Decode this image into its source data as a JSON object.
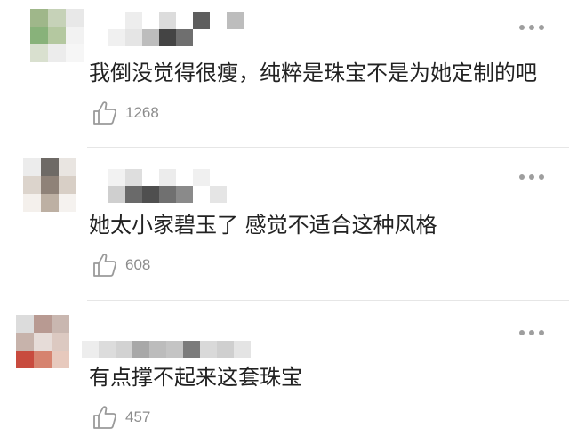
{
  "colors": {
    "text": "#222222",
    "muted": "#8c8c8c",
    "divider": "#e6e6e6"
  },
  "comments": [
    {
      "text": "我倒没觉得很瘦，纯粹是珠宝不是为她定制的吧",
      "likes": "1268",
      "like_icon": "thumbs-up-icon",
      "more_icon": "more-dots-icon",
      "avatar_pixels": [
        "#9fb78a",
        "#c6d2b8",
        "#e8e8e8",
        "#88b27a",
        "#b4c8a0",
        "#f2f2f2",
        "#d9e0cf",
        "#ececec",
        "#f6f6f6"
      ],
      "name_pixels": [
        "#ffffff",
        "#ffffff",
        "#ededed",
        "#ffffff",
        "#dcdcdc",
        "#ffffff",
        "#5e5e5e",
        "#ffffff",
        "#bdbdbd",
        "#ffffff",
        "#ffffff",
        "#ffffff",
        "#ffffff",
        "#f0f0f0",
        "#e5e5e5",
        "#bdbdbd",
        "#444444",
        "#6f6f6f",
        "#ffffff",
        "#ffffff",
        "#ffffff",
        "#ffffff",
        "#ffffff",
        "#ffffff"
      ]
    },
    {
      "text": "她太小家碧玉了 感觉不适合这种风格",
      "likes": "608",
      "like_icon": "thumbs-up-icon",
      "more_icon": "more-dots-icon",
      "avatar_pixels": [
        "#ececec",
        "#6e6a66",
        "#e9e5e1",
        "#dcd4cc",
        "#8f8278",
        "#d8cfc6",
        "#f4f0ec",
        "#bdb0a3",
        "#f5f2ef"
      ],
      "name_pixels": [
        "#ffffff",
        "#f2f2f2",
        "#dedede",
        "#ffffff",
        "#ececec",
        "#ffffff",
        "#f0f0f0",
        "#ffffff",
        "#ffffff",
        "#ffffff",
        "#ffffff",
        "#ffffff",
        "#ffffff",
        "#cfcfcf",
        "#6a6a6a",
        "#4f4f4f",
        "#707070",
        "#8a8a8a",
        "#ffffff",
        "#e5e5e5",
        "#ffffff",
        "#ffffff",
        "#ffffff",
        "#ffffff"
      ]
    },
    {
      "text": "有点撑不起来这套珠宝",
      "likes": "457",
      "like_icon": "thumbs-up-icon",
      "more_icon": "more-dots-icon",
      "avatar_pixels": [
        "#dcdcdc",
        "#b89a92",
        "#c9b7b0",
        "#c7b3ab",
        "#e6dcd8",
        "#dcc9c1",
        "#c84b3e",
        "#d6836f",
        "#e7c9bd"
      ],
      "name_pixels": [
        "#ffffff",
        "#ffffff",
        "#ffffff",
        "#ffffff",
        "#ffffff",
        "#ffffff",
        "#ffffff",
        "#ffffff",
        "#ffffff",
        "#ffffff",
        "#ffffff",
        "#ffffff",
        "#ededed",
        "#dcdcdc",
        "#d2d2d2",
        "#a8a8a8",
        "#bcbcbc",
        "#c4c4c4",
        "#7b7b7b",
        "#d9d9d9",
        "#cfcfcf",
        "#e4e4e4",
        "#ffffff",
        "#ffffff"
      ]
    }
  ]
}
